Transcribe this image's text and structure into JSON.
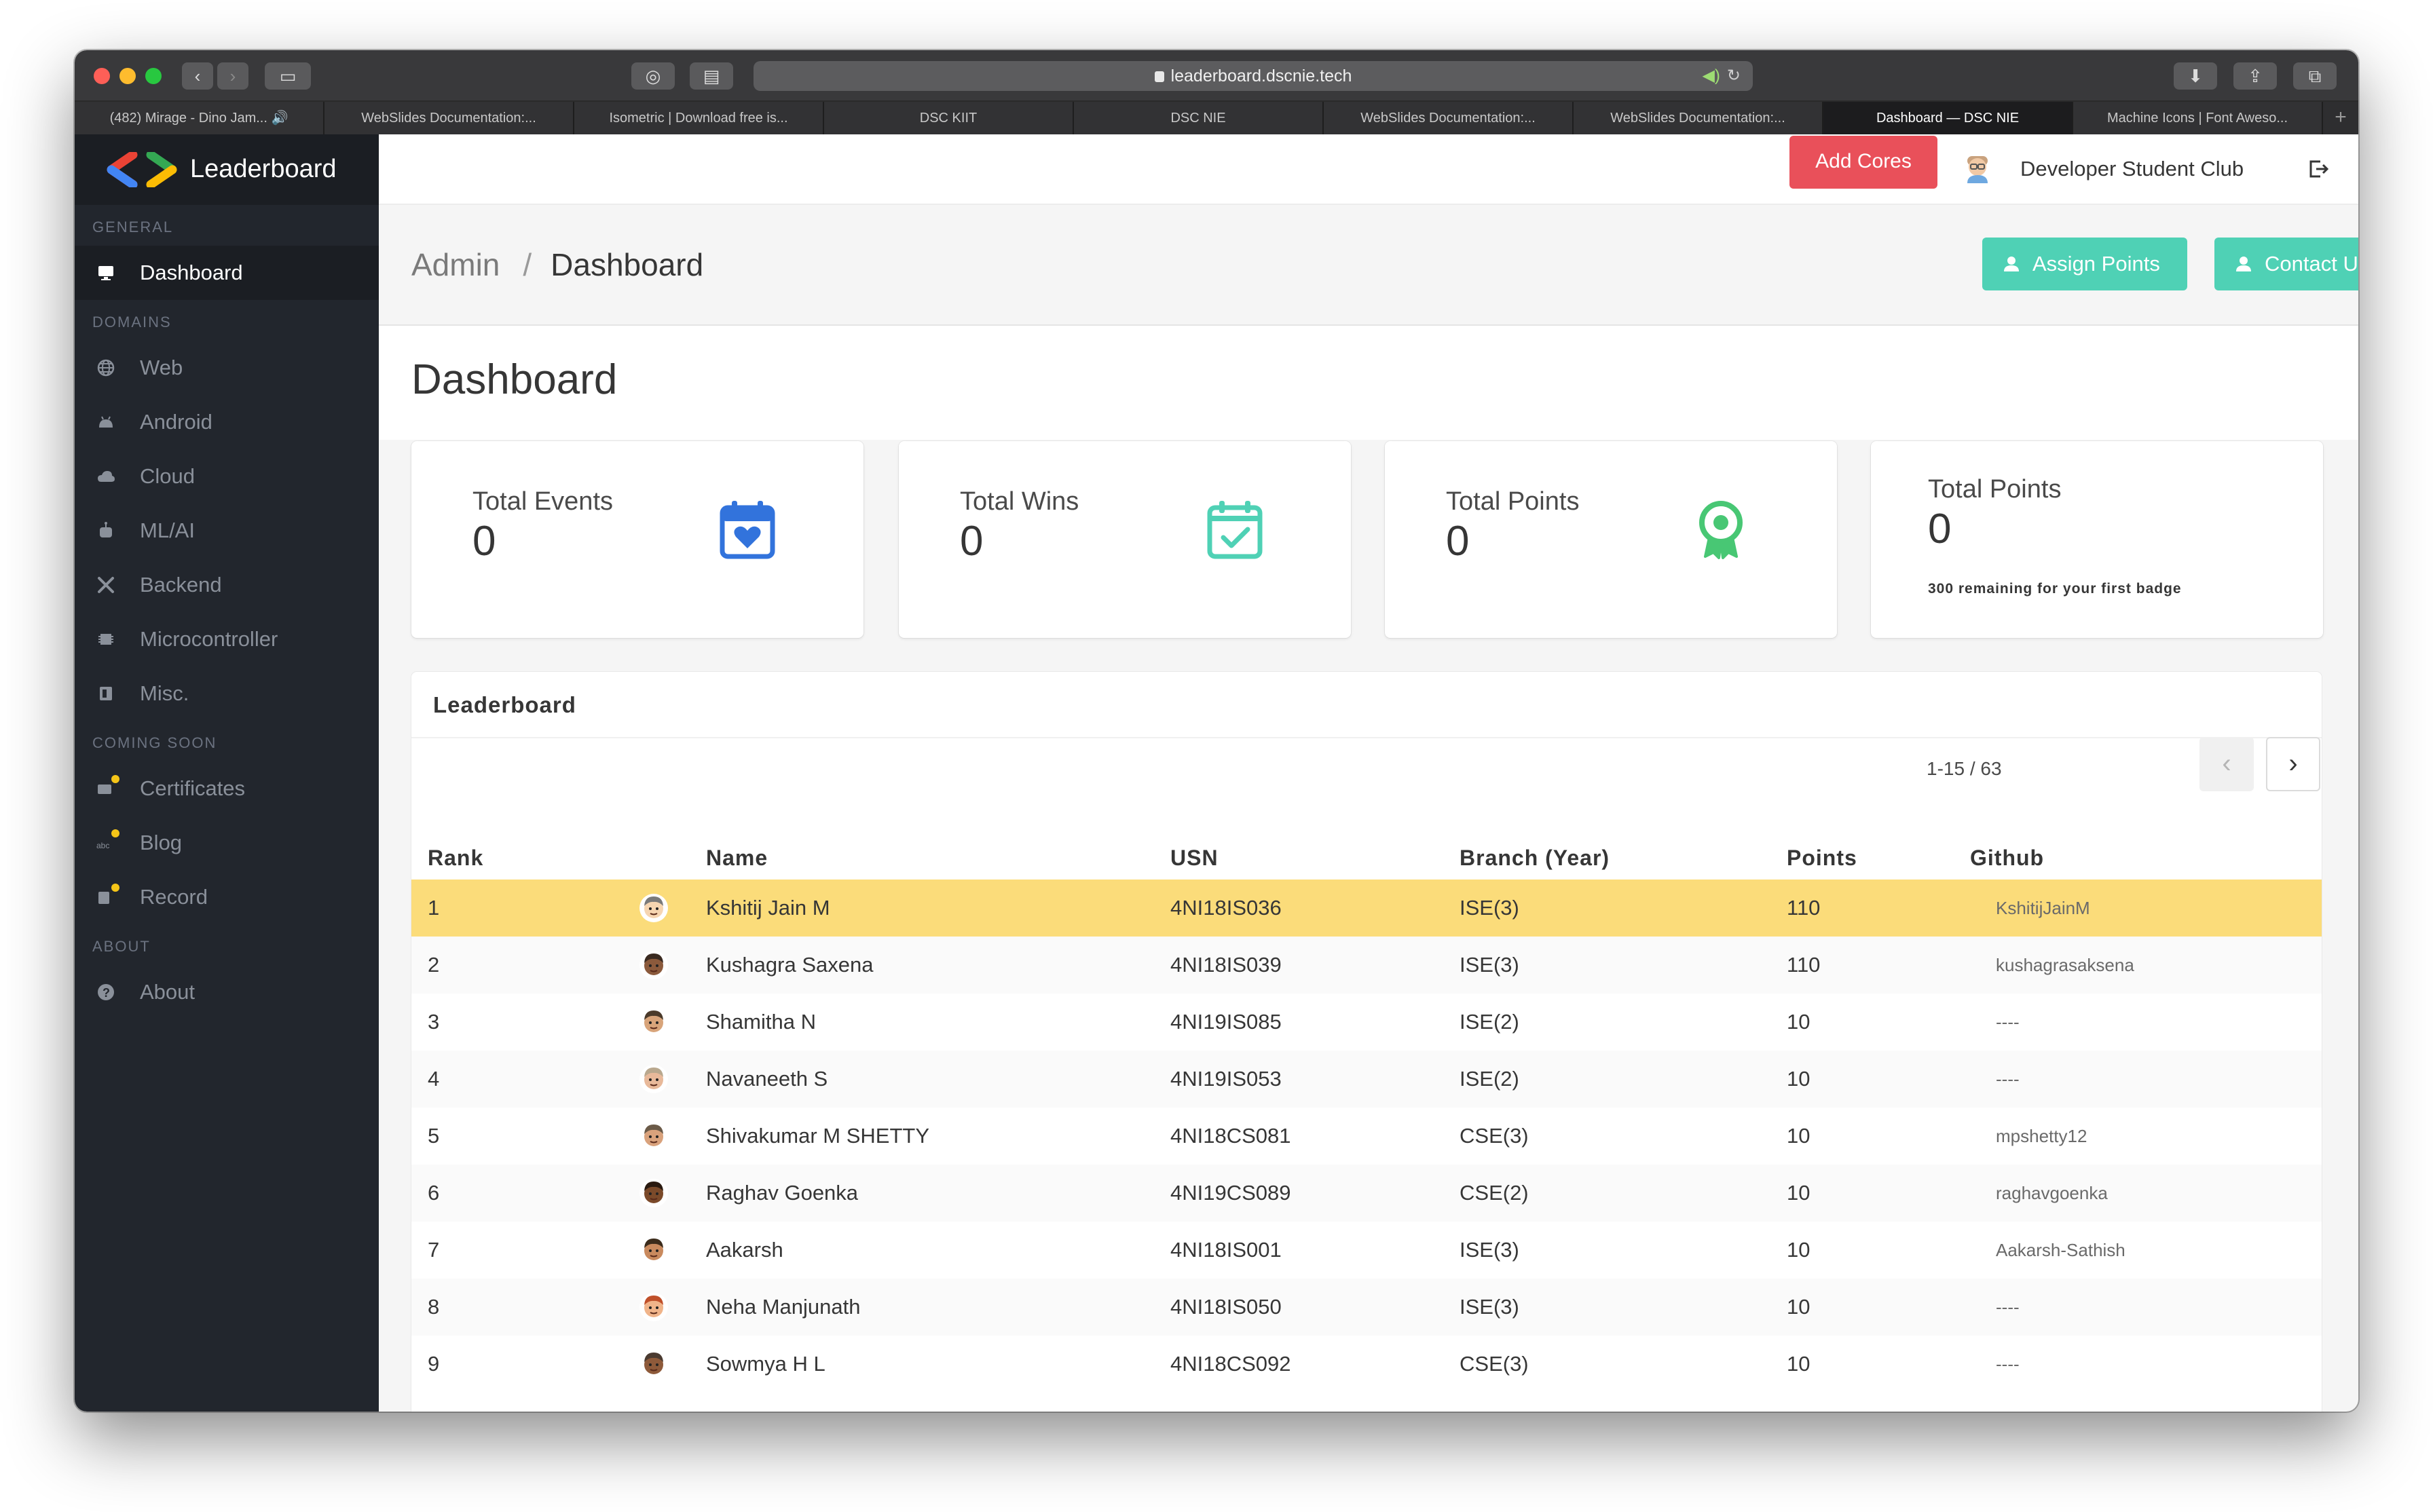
{
  "browser": {
    "url": "leaderboard.dscnie.tech",
    "tabs": [
      {
        "label": "(482) Mirage - Dino Jam... 🔊",
        "active": false
      },
      {
        "label": "WebSlides Documentation:...",
        "active": false
      },
      {
        "label": "Isometric | Download free is...",
        "active": false
      },
      {
        "label": "DSC KIIT",
        "active": false
      },
      {
        "label": "DSC NIE",
        "active": false
      },
      {
        "label": "WebSlides Documentation:...",
        "active": false
      },
      {
        "label": "WebSlides Documentation:...",
        "active": false
      },
      {
        "label": "Dashboard — DSC NIE",
        "active": true
      },
      {
        "label": "Machine Icons | Font Aweso...",
        "active": false
      }
    ],
    "new_tab": "+"
  },
  "sidebar": {
    "brand": "Leaderboard",
    "sections": [
      {
        "title": "GENERAL",
        "items": [
          {
            "label": "Dashboard",
            "icon": "monitor-icon",
            "active": true
          }
        ]
      },
      {
        "title": "DOMAINS",
        "items": [
          {
            "label": "Web",
            "icon": "globe-icon"
          },
          {
            "label": "Android",
            "icon": "android-icon"
          },
          {
            "label": "Cloud",
            "icon": "cloud-icon"
          },
          {
            "label": "ML/AI",
            "icon": "robot-icon"
          },
          {
            "label": "Backend",
            "icon": "tools-icon"
          },
          {
            "label": "Microcontroller",
            "icon": "chip-icon"
          },
          {
            "label": "Misc.",
            "icon": "box-icon"
          }
        ]
      },
      {
        "title": "COMING SOON",
        "items": [
          {
            "label": "Certificates",
            "icon": "certificate-icon"
          },
          {
            "label": "Blog",
            "icon": "blog-icon"
          },
          {
            "label": "Record",
            "icon": "record-icon"
          }
        ]
      },
      {
        "title": "ABOUT",
        "items": [
          {
            "label": "About",
            "icon": "question-icon"
          }
        ]
      }
    ]
  },
  "topnav": {
    "add_cores": "Add Cores",
    "user_name": "Developer Student Club"
  },
  "header": {
    "crumb_parent": "Admin",
    "crumb_sep": "/",
    "crumb_current": "Dashboard",
    "assign_points": "Assign Points",
    "contact_us": "Contact Us"
  },
  "page_title": "Dashboard",
  "cards": [
    {
      "label": "Total Events",
      "value": "0",
      "icon": "calendar-heart-icon",
      "color": "#3273dc"
    },
    {
      "label": "Total Wins",
      "value": "0",
      "icon": "calendar-check-icon",
      "color": "#4fd1b5"
    },
    {
      "label": "Total Points",
      "value": "0",
      "icon": "award-icon",
      "color": "#48c774"
    },
    {
      "label": "Total Points",
      "value": "0",
      "sub": "300 remaining for your first badge"
    }
  ],
  "leaderboard": {
    "title": "Leaderboard",
    "pager": "1-15 / 63",
    "prev": "‹",
    "next": "›",
    "columns": [
      "Rank",
      "",
      "Name",
      "USN",
      "Branch (Year)",
      "Points",
      "Github"
    ],
    "rows": [
      {
        "rank": "1",
        "name": "Kshitij Jain M",
        "usn": "4NI18IS036",
        "branch": "ISE(3)",
        "points": "110",
        "github": "KshitijJainM",
        "highlight": true
      },
      {
        "rank": "2",
        "name": "Kushagra Saxena",
        "usn": "4NI18IS039",
        "branch": "ISE(3)",
        "points": "110",
        "github": "kushagrasaksena"
      },
      {
        "rank": "3",
        "name": "Shamitha N",
        "usn": "4NI19IS085",
        "branch": "ISE(2)",
        "points": "10",
        "github": "----"
      },
      {
        "rank": "4",
        "name": "Navaneeth S",
        "usn": "4NI19IS053",
        "branch": "ISE(2)",
        "points": "10",
        "github": "----"
      },
      {
        "rank": "5",
        "name": "Shivakumar M SHETTY",
        "usn": "4NI18CS081",
        "branch": "CSE(3)",
        "points": "10",
        "github": "mpshetty12"
      },
      {
        "rank": "6",
        "name": "Raghav Goenka",
        "usn": "4NI19CS089",
        "branch": "CSE(2)",
        "points": "10",
        "github": "raghavgoenka"
      },
      {
        "rank": "7",
        "name": "Aakarsh",
        "usn": "4NI18IS001",
        "branch": "ISE(3)",
        "points": "10",
        "github": "Aakarsh-Sathish"
      },
      {
        "rank": "8",
        "name": "Neha Manjunath",
        "usn": "4NI18IS050",
        "branch": "ISE(3)",
        "points": "10",
        "github": "----"
      },
      {
        "rank": "9",
        "name": "Sowmya H L",
        "usn": "4NI18CS092",
        "branch": "CSE(3)",
        "points": "10",
        "github": "----"
      }
    ]
  }
}
